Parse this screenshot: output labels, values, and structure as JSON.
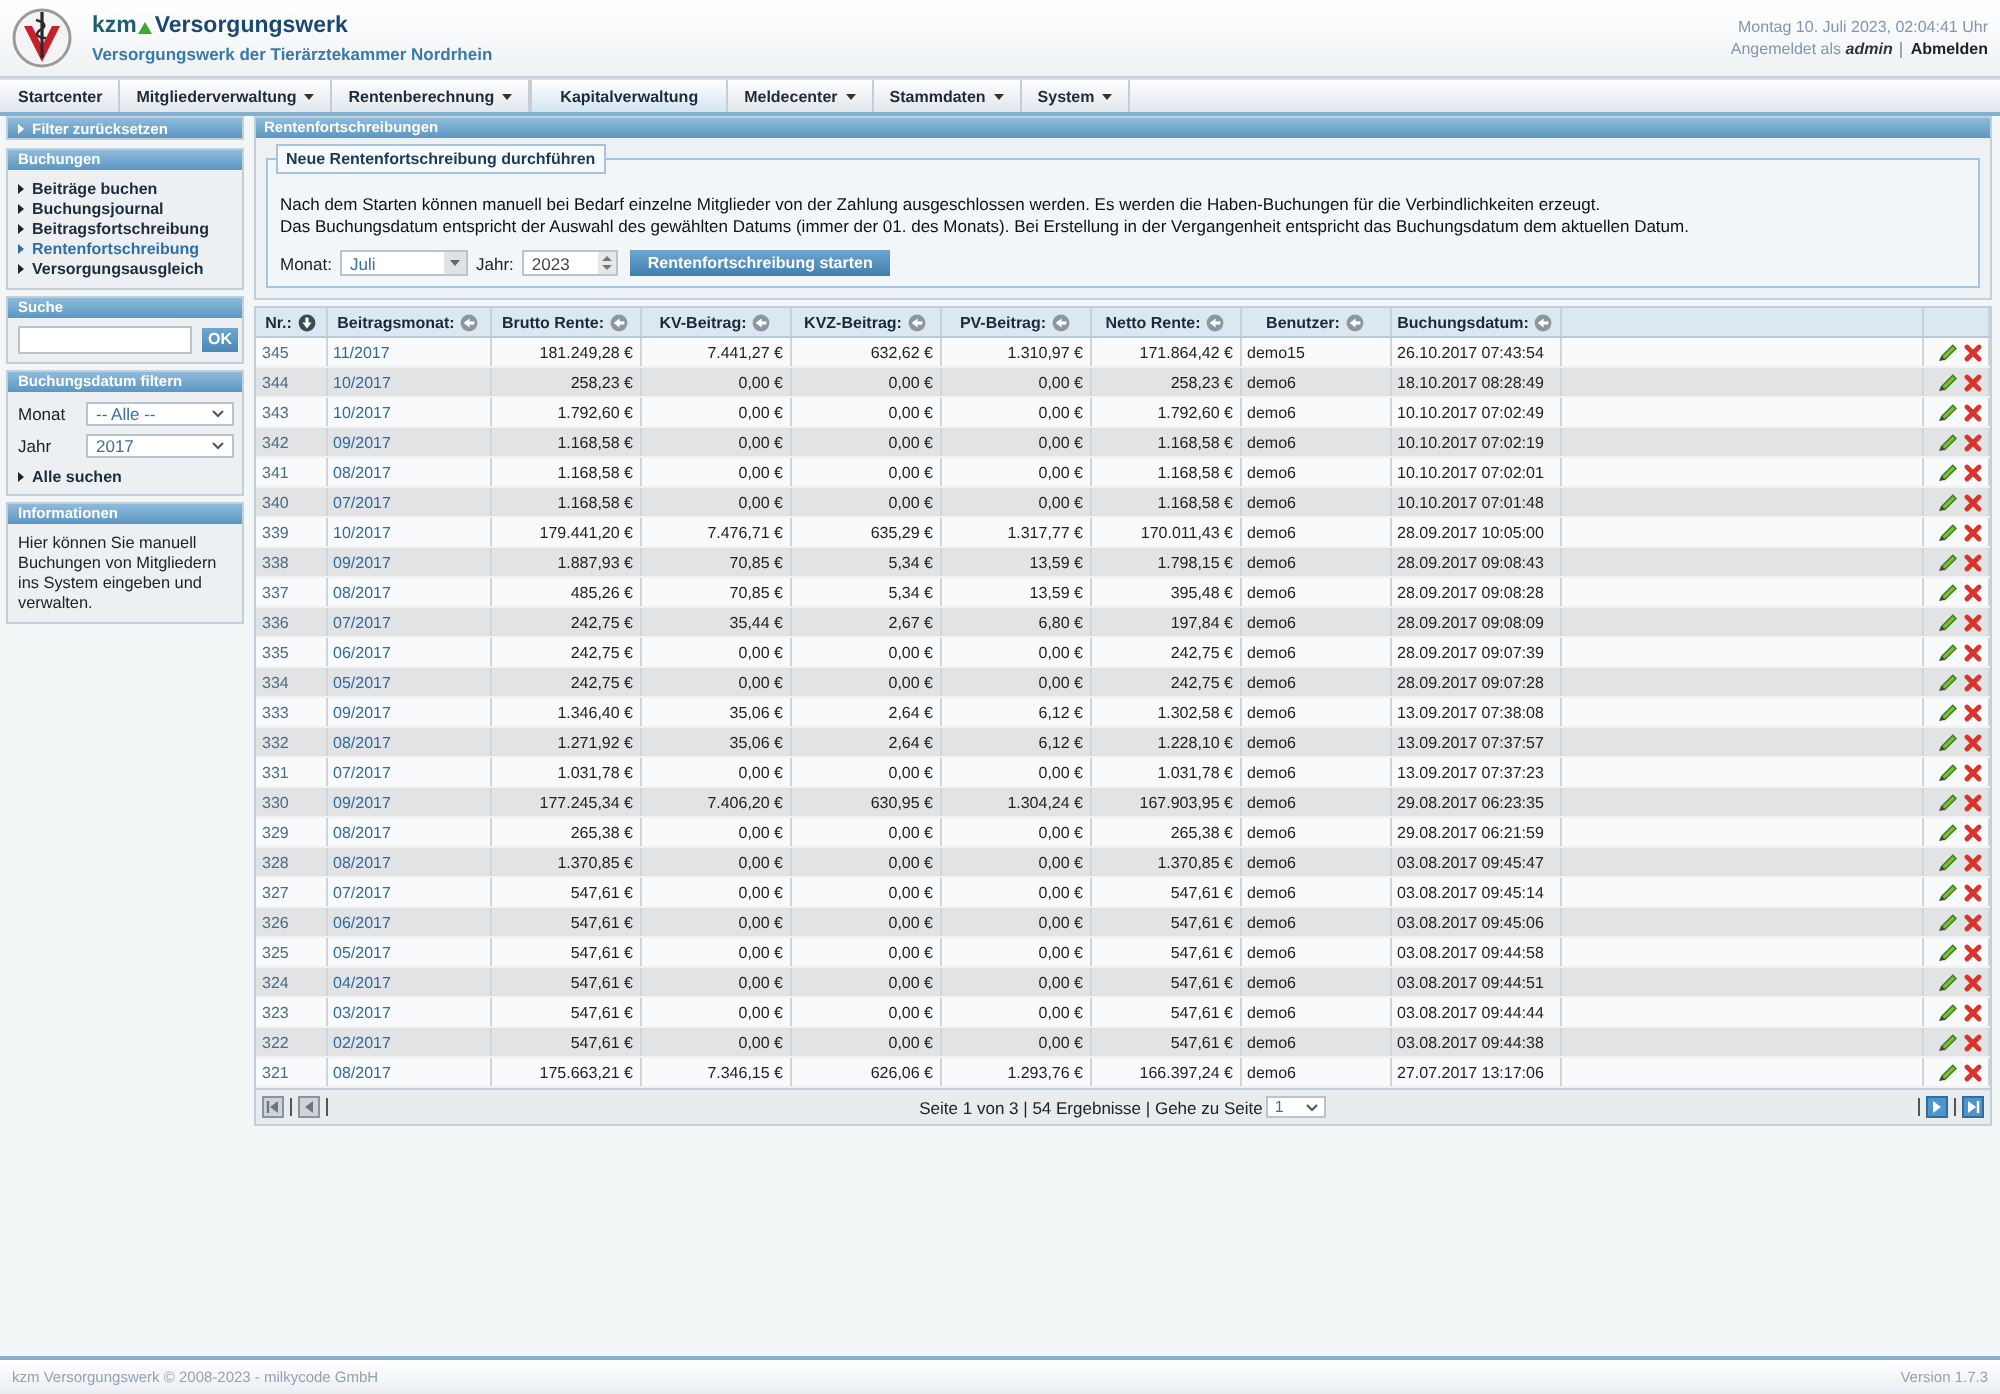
{
  "header": {
    "brand_prefix": "kzm",
    "brand_name": "Versorgungswerk",
    "subtitle": "Versorgungswerk der Tierärztekammer Nordrhein",
    "datetime": "Montag 10. Juli 2023, 02:04:41 Uhr",
    "login": "Angemeldet als **admin**",
    "logout": "Abmelden"
  },
  "nav": [
    {
      "label": "Startcenter",
      "has_menu": false,
      "selected": false
    },
    {
      "label": "Mitgliederverwaltung",
      "has_menu": true,
      "selected": false
    },
    {
      "label": "Rentenberechnung",
      "has_menu": true,
      "selected": false
    },
    {
      "label": "Kapitalverwaltung",
      "has_menu": false,
      "selected": true
    },
    {
      "label": "Meldecenter",
      "has_menu": true,
      "selected": false
    },
    {
      "label": "Stammdaten",
      "has_menu": true,
      "selected": false
    },
    {
      "label": "System",
      "has_menu": true,
      "selected": false
    }
  ],
  "sidebar": {
    "reset_filter": "Filter zurücksetzen",
    "sections": [
      {
        "kind": "menu",
        "title": "Buchungen",
        "items": [
          {
            "label": "Beiträge buchen",
            "selected": false
          },
          {
            "label": "Buchungsjournal",
            "selected": false
          },
          {
            "label": "Beitragsfortschreibung",
            "selected": false
          },
          {
            "label": "Rentenfortschreibung",
            "selected": true
          },
          {
            "label": "Versorgungsausgleich",
            "selected": false
          }
        ]
      },
      {
        "kind": "search",
        "title": "Suche",
        "button": "OK"
      },
      {
        "kind": "date_filter",
        "title": "Buchungsdatum filtern",
        "fields": [
          {
            "label": "Monat",
            "value": "-- Alle --"
          },
          {
            "label": "Jahr",
            "value": "2017"
          }
        ],
        "link": "Alle suchen"
      },
      {
        "kind": "info",
        "title": "Informationen",
        "text": "Hier können Sie manuell Buchungen von Mitgliedern ins System eingeben und verwalten."
      }
    ]
  },
  "main": {
    "title": "Rentenfortschreibungen",
    "form": {
      "legend": "Neue Rentenfortschreibung durchführen",
      "description": [
        "Nach dem Starten können manuell bei Bedarf einzelne Mitglieder von der Zahlung ausgeschlossen werden. Es werden die Haben-Buchungen für die Verbindlichkeiten erzeugt.",
        "Das Buchungsdatum entspricht der Auswahl des gewählten Datums (immer der 01. des Monats). Bei Erstellung in der Vergangenheit entspricht das Buchungsdatum dem aktuellen Datum."
      ],
      "month_label": "Monat:",
      "month": "Juli",
      "year_label": "Jahr:",
      "year": "2023",
      "button": "Rentenfortschreibung starten"
    },
    "table": {
      "columns": [
        {
          "label": "Nr.:",
          "kind": "id",
          "sorted": true
        },
        {
          "label": "Beitragsmonat:",
          "kind": "link",
          "sorted": false
        },
        {
          "label": "Brutto Rente:",
          "kind": "amount",
          "sorted": false
        },
        {
          "label": "KV-Beitrag:",
          "kind": "amount",
          "sorted": false
        },
        {
          "label": "KVZ-Beitrag:",
          "kind": "amount",
          "sorted": false
        },
        {
          "label": "PV-Beitrag:",
          "kind": "amount",
          "sorted": false
        },
        {
          "label": "Netto Rente:",
          "kind": "amount",
          "sorted": false
        },
        {
          "label": "Benutzer:",
          "kind": "text",
          "sorted": false
        },
        {
          "label": "Buchungsdatum:",
          "kind": "text",
          "sorted": false
        }
      ],
      "rows": [
        [
          "345",
          "11/2017",
          "181.249,28 €",
          "7.441,27 €",
          "632,62 €",
          "1.310,97 €",
          "171.864,42 €",
          "demo15",
          "26.10.2017 07:43:54"
        ],
        [
          "344",
          "10/2017",
          "258,23 €",
          "0,00 €",
          "0,00 €",
          "0,00 €",
          "258,23 €",
          "demo6",
          "18.10.2017 08:28:49"
        ],
        [
          "343",
          "10/2017",
          "1.792,60 €",
          "0,00 €",
          "0,00 €",
          "0,00 €",
          "1.792,60 €",
          "demo6",
          "10.10.2017 07:02:49"
        ],
        [
          "342",
          "09/2017",
          "1.168,58 €",
          "0,00 €",
          "0,00 €",
          "0,00 €",
          "1.168,58 €",
          "demo6",
          "10.10.2017 07:02:19"
        ],
        [
          "341",
          "08/2017",
          "1.168,58 €",
          "0,00 €",
          "0,00 €",
          "0,00 €",
          "1.168,58 €",
          "demo6",
          "10.10.2017 07:02:01"
        ],
        [
          "340",
          "07/2017",
          "1.168,58 €",
          "0,00 €",
          "0,00 €",
          "0,00 €",
          "1.168,58 €",
          "demo6",
          "10.10.2017 07:01:48"
        ],
        [
          "339",
          "10/2017",
          "179.441,20 €",
          "7.476,71 €",
          "635,29 €",
          "1.317,77 €",
          "170.011,43 €",
          "demo6",
          "28.09.2017 10:05:00"
        ],
        [
          "338",
          "09/2017",
          "1.887,93 €",
          "70,85 €",
          "5,34 €",
          "13,59 €",
          "1.798,15 €",
          "demo6",
          "28.09.2017 09:08:43"
        ],
        [
          "337",
          "08/2017",
          "485,26 €",
          "70,85 €",
          "5,34 €",
          "13,59 €",
          "395,48 €",
          "demo6",
          "28.09.2017 09:08:28"
        ],
        [
          "336",
          "07/2017",
          "242,75 €",
          "35,44 €",
          "2,67 €",
          "6,80 €",
          "197,84 €",
          "demo6",
          "28.09.2017 09:08:09"
        ],
        [
          "335",
          "06/2017",
          "242,75 €",
          "0,00 €",
          "0,00 €",
          "0,00 €",
          "242,75 €",
          "demo6",
          "28.09.2017 09:07:39"
        ],
        [
          "334",
          "05/2017",
          "242,75 €",
          "0,00 €",
          "0,00 €",
          "0,00 €",
          "242,75 €",
          "demo6",
          "28.09.2017 09:07:28"
        ],
        [
          "333",
          "09/2017",
          "1.346,40 €",
          "35,06 €",
          "2,64 €",
          "6,12 €",
          "1.302,58 €",
          "demo6",
          "13.09.2017 07:38:08"
        ],
        [
          "332",
          "08/2017",
          "1.271,92 €",
          "35,06 €",
          "2,64 €",
          "6,12 €",
          "1.228,10 €",
          "demo6",
          "13.09.2017 07:37:57"
        ],
        [
          "331",
          "07/2017",
          "1.031,78 €",
          "0,00 €",
          "0,00 €",
          "0,00 €",
          "1.031,78 €",
          "demo6",
          "13.09.2017 07:37:23"
        ],
        [
          "330",
          "09/2017",
          "177.245,34 €",
          "7.406,20 €",
          "630,95 €",
          "1.304,24 €",
          "167.903,95 €",
          "demo6",
          "29.08.2017 06:23:35"
        ],
        [
          "329",
          "08/2017",
          "265,38 €",
          "0,00 €",
          "0,00 €",
          "0,00 €",
          "265,38 €",
          "demo6",
          "29.08.2017 06:21:59"
        ],
        [
          "328",
          "08/2017",
          "1.370,85 €",
          "0,00 €",
          "0,00 €",
          "0,00 €",
          "1.370,85 €",
          "demo6",
          "03.08.2017 09:45:47"
        ],
        [
          "327",
          "07/2017",
          "547,61 €",
          "0,00 €",
          "0,00 €",
          "0,00 €",
          "547,61 €",
          "demo6",
          "03.08.2017 09:45:14"
        ],
        [
          "326",
          "06/2017",
          "547,61 €",
          "0,00 €",
          "0,00 €",
          "0,00 €",
          "547,61 €",
          "demo6",
          "03.08.2017 09:45:06"
        ],
        [
          "325",
          "05/2017",
          "547,61 €",
          "0,00 €",
          "0,00 €",
          "0,00 €",
          "547,61 €",
          "demo6",
          "03.08.2017 09:44:58"
        ],
        [
          "324",
          "04/2017",
          "547,61 €",
          "0,00 €",
          "0,00 €",
          "0,00 €",
          "547,61 €",
          "demo6",
          "03.08.2017 09:44:51"
        ],
        [
          "323",
          "03/2017",
          "547,61 €",
          "0,00 €",
          "0,00 €",
          "0,00 €",
          "547,61 €",
          "demo6",
          "03.08.2017 09:44:44"
        ],
        [
          "322",
          "02/2017",
          "547,61 €",
          "0,00 €",
          "0,00 €",
          "0,00 €",
          "547,61 €",
          "demo6",
          "03.08.2017 09:44:38"
        ],
        [
          "321",
          "08/2017",
          "175.663,21 €",
          "7.346,15 €",
          "626,06 €",
          "1.293,76 €",
          "166.397,24 €",
          "demo6",
          "27.07.2017 13:17:06"
        ]
      ]
    },
    "pager": {
      "buttons": [
        {
          "kind": "first",
          "disabled": true
        },
        {
          "kind": "prev",
          "disabled": true
        },
        {
          "kind": "next",
          "disabled": false
        },
        {
          "kind": "last",
          "disabled": false
        }
      ],
      "summary": "Seite 1 von 3 | 54 Ergebnisse | Gehe zu Seite",
      "page": "1"
    }
  },
  "footer": {
    "copyright": "kzm Versorgungswerk © 2008-2023 - milkycode GmbH",
    "version": "Version 1.7.3"
  }
}
